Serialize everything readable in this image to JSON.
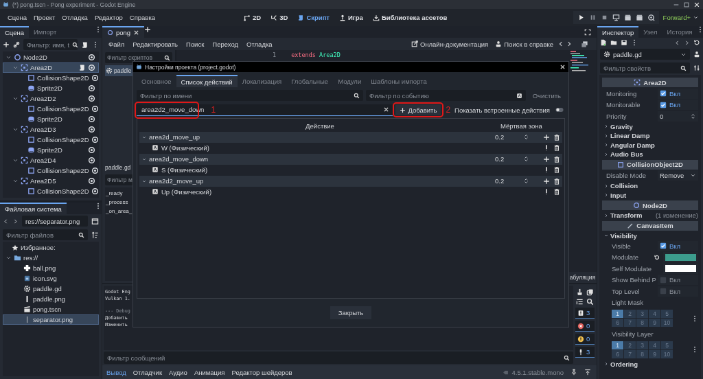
{
  "window": {
    "title": "(*) pong.tscn - Pong experiment - Godot Engine"
  },
  "menu": [
    "Сцена",
    "Проект",
    "Отладка",
    "Редактор",
    "Справка"
  ],
  "workspaces": [
    {
      "label": "2D",
      "kind": "plane",
      "selected": false
    },
    {
      "label": "3D",
      "kind": "space",
      "selected": false
    },
    {
      "label": "Скрипт",
      "kind": "script",
      "selected": true
    },
    {
      "label": "Игра",
      "kind": "game",
      "selected": false
    },
    {
      "label": "Библиотека ассетов",
      "kind": "assets",
      "selected": false
    }
  ],
  "renderer": "Forward+",
  "scene_dock": {
    "tabs": [
      {
        "label": "Сцена",
        "selected": true
      },
      {
        "label": "Импорт",
        "selected": false
      }
    ],
    "filter": {
      "placeholder": "Фильтр: имя, t"
    },
    "tree": [
      {
        "name": "Node2D",
        "kind": "node2d",
        "selected": false,
        "has_script": false,
        "expanded": true,
        "children": [
          {
            "name": "Area2D",
            "kind": "area2d",
            "selected": true,
            "has_script": true,
            "expanded": true,
            "children": [
              {
                "name": "CollisionShape2D",
                "kind": "collision",
                "selected": false,
                "has_script": false
              },
              {
                "name": "Sprite2D",
                "kind": "sprite",
                "selected": false,
                "has_script": false
              }
            ]
          },
          {
            "name": "Area2D2",
            "kind": "area2d",
            "selected": false,
            "has_script": false,
            "expanded": true,
            "children": [
              {
                "name": "CollisionShape2D",
                "kind": "collision",
                "selected": false,
                "has_script": false
              },
              {
                "name": "Sprite2D",
                "kind": "sprite",
                "selected": false,
                "has_script": false
              }
            ]
          },
          {
            "name": "Area2D3",
            "kind": "area2d",
            "selected": false,
            "has_script": false,
            "expanded": true,
            "children": [
              {
                "name": "CollisionShape2D",
                "kind": "collision",
                "selected": false,
                "has_script": false
              },
              {
                "name": "Sprite2D",
                "kind": "sprite",
                "selected": false,
                "has_script": false
              }
            ]
          },
          {
            "name": "Area2D4",
            "kind": "area2d",
            "selected": false,
            "has_script": false,
            "expanded": true,
            "children": [
              {
                "name": "CollisionShape2D",
                "kind": "collision",
                "selected": false,
                "has_script": false
              }
            ]
          },
          {
            "name": "Area2D5",
            "kind": "area2d",
            "selected": false,
            "has_script": false,
            "expanded": true,
            "children": [
              {
                "name": "CollisionShape2D",
                "kind": "collision",
                "selected": false,
                "has_script": false
              }
            ]
          }
        ]
      }
    ]
  },
  "filesystem": {
    "tab": "Файловая система",
    "path": "res://separator.png",
    "filter": {
      "placeholder": "Фильтр файлов"
    },
    "favorites": "Избранное:",
    "tree": [
      {
        "name": "res://",
        "kind": "folder",
        "selected": false,
        "expanded": true,
        "children": [
          {
            "name": "ball.png",
            "kind": "ball",
            "selected": false
          },
          {
            "name": "icon.svg",
            "kind": "svg",
            "selected": false
          },
          {
            "name": "paddle.gd",
            "kind": "script",
            "selected": false
          },
          {
            "name": "paddle.png",
            "kind": "paddle",
            "selected": false
          },
          {
            "name": "pong.tscn",
            "kind": "scene",
            "selected": false
          },
          {
            "name": "separator.png",
            "kind": "separator",
            "selected": true
          }
        ]
      }
    ]
  },
  "editor": {
    "tabs": [
      {
        "label": "pong",
        "selected": true
      }
    ],
    "menu": [
      "Файл",
      "Редактировать",
      "Поиск",
      "Переход",
      "Отладка"
    ],
    "links": [
      "Онлайн-документация",
      "Поиск в справке"
    ],
    "script_filter": {
      "placeholder": "Фильтр скриптов"
    },
    "scripts": [
      {
        "name": "paddle",
        "selected": true
      }
    ],
    "script_name": "paddle.gd",
    "method_filter": {
      "placeholder": "Фильтр м"
    },
    "methods": [
      "_ready",
      "_process",
      "_on_area_"
    ],
    "code": [
      {
        "line": "1",
        "keyword": "extends",
        "text": "Area2D"
      }
    ],
    "status": "абуляция"
  },
  "output": {
    "header_lines": [
      "Godot Eng",
      "Vulkan 1."
    ],
    "log_lines": [
      "--- Debug",
      "Добавить",
      "Изменить"
    ],
    "filter": {
      "placeholder": "Фильтр сообщений"
    },
    "counters": [
      {
        "kind": "message",
        "count": "3"
      },
      {
        "kind": "error",
        "count": "0"
      },
      {
        "kind": "warning",
        "count": "0"
      },
      {
        "kind": "editor",
        "count": "3"
      }
    ],
    "tabs": [
      {
        "label": "Вывод",
        "selected": true
      },
      {
        "label": "Отладчик",
        "selected": false
      },
      {
        "label": "Аудио",
        "selected": false
      },
      {
        "label": "Анимация",
        "selected": false
      },
      {
        "label": "Редактор шейдеров",
        "selected": false
      }
    ],
    "version": "4.5.1.stable.mono"
  },
  "inspector": {
    "tabs": [
      {
        "label": "Инспектор",
        "selected": true
      },
      {
        "label": "Узел",
        "selected": false
      },
      {
        "label": "История",
        "selected": false
      }
    ],
    "resource": "paddle.gd",
    "filter": {
      "placeholder": "Фильтр свойств"
    },
    "properties": [
      {
        "kind": "header",
        "label": "Area2D"
      },
      {
        "kind": "check",
        "label": "Monitoring",
        "value": "Вкл",
        "checked": true
      },
      {
        "kind": "check",
        "label": "Monitorable",
        "value": "Вкл",
        "checked": true
      },
      {
        "kind": "number",
        "label": "Priority",
        "value": "0"
      },
      {
        "kind": "group",
        "label": "Gravity",
        "expanded": false
      },
      {
        "kind": "group",
        "label": "Linear Damp",
        "expanded": false
      },
      {
        "kind": "group",
        "label": "Angular Damp",
        "expanded": false
      },
      {
        "kind": "group",
        "label": "Audio Bus",
        "expanded": false
      },
      {
        "kind": "header",
        "label": "CollisionObject2D"
      },
      {
        "kind": "select",
        "label": "Disable Mode",
        "value": "Remove"
      },
      {
        "kind": "group",
        "label": "Collision",
        "expanded": false
      },
      {
        "kind": "group",
        "label": "Input",
        "expanded": false
      },
      {
        "kind": "header",
        "label": "Node2D"
      },
      {
        "kind": "group",
        "label": "Transform",
        "expanded": false,
        "note": "(1 изменение)"
      },
      {
        "kind": "header",
        "label": "CanvasItem"
      },
      {
        "kind": "group",
        "label": "Visibility",
        "expanded": true,
        "children": [
          {
            "kind": "check",
            "label": "Visible",
            "value": "Вкл",
            "checked": true
          },
          {
            "kind": "color",
            "label": "Modulate",
            "color": "#3c9c8d",
            "changed": true
          },
          {
            "kind": "color",
            "label": "Self Modulate",
            "color": "#ffffff",
            "changed": false
          },
          {
            "kind": "check",
            "label": "Show Behind P",
            "value": "Вкл",
            "checked": false
          },
          {
            "kind": "check",
            "label": "Top Level",
            "value": "Вкл",
            "checked": false
          },
          {
            "kind": "layers",
            "label": "Light Mask",
            "cells": [
              {
                "label": "1",
                "selected": true
              },
              {
                "label": "2",
                "selected": false
              },
              {
                "label": "3",
                "selected": false
              },
              {
                "label": "4",
                "selected": false
              },
              {
                "label": "5",
                "selected": false
              },
              {
                "label": "6",
                "selected": false
              },
              {
                "label": "7",
                "selected": false
              },
              {
                "label": "8",
                "selected": false
              },
              {
                "label": "9",
                "selected": false
              },
              {
                "label": "10",
                "selected": false
              }
            ]
          },
          {
            "kind": "layers",
            "label": "Visibility Layer",
            "cells": [
              {
                "label": "1",
                "selected": true
              },
              {
                "label": "2",
                "selected": false
              },
              {
                "label": "3",
                "selected": false
              },
              {
                "label": "4",
                "selected": false
              },
              {
                "label": "5",
                "selected": false
              },
              {
                "label": "6",
                "selected": false
              },
              {
                "label": "7",
                "selected": false
              },
              {
                "label": "8",
                "selected": false
              },
              {
                "label": "9",
                "selected": false
              },
              {
                "label": "10",
                "selected": false
              }
            ]
          }
        ]
      },
      {
        "kind": "group",
        "label": "Ordering",
        "expanded": false
      }
    ]
  },
  "dialog": {
    "title": "Настройки проекта (project.godot)",
    "tabs": [
      {
        "label": "Основное",
        "selected": false
      },
      {
        "label": "Список действий",
        "selected": true
      },
      {
        "label": "Локализация",
        "selected": false
      },
      {
        "label": "Глобальные",
        "selected": false
      },
      {
        "label": "Модули",
        "selected": false
      },
      {
        "label": "Шаблоны импорта",
        "selected": false
      }
    ],
    "name_filter": {
      "placeholder": "Фильтр по имени"
    },
    "event_filter": {
      "placeholder": "Фильтр по событию"
    },
    "clear_button": "Очистить",
    "new_action": {
      "value": "area2d2_move_down",
      "annotation": "1"
    },
    "add_button": {
      "label": "Добавить",
      "annotation": "2"
    },
    "show_builtin": {
      "label": "Показать встроенные действия",
      "on": false
    },
    "columns": [
      "Действие",
      "Мёртвая зона"
    ],
    "actions": [
      {
        "name": "area2d_move_up",
        "deadzone": "0.2",
        "expanded": true,
        "children": [
          {
            "name": "W (Физический)"
          }
        ]
      },
      {
        "name": "area2d_move_down",
        "deadzone": "0.2",
        "expanded": true,
        "children": [
          {
            "name": "S (Физический)"
          }
        ]
      },
      {
        "name": "area2d2_move_up",
        "deadzone": "0.2",
        "expanded": true,
        "children": [
          {
            "name": "Up (Физический)"
          }
        ]
      }
    ],
    "close_button": "Закрыть"
  }
}
